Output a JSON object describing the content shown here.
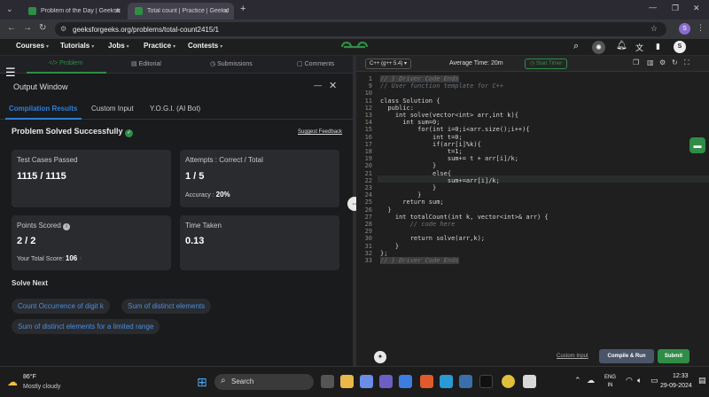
{
  "browser": {
    "tabs": [
      {
        "label": "Problem of the Day | GeeksforG"
      },
      {
        "label": "Total count | Practice | Geeksfo"
      }
    ],
    "url": "geeksforgeeks.org/problems/total-count2415/1",
    "profile_initial": "S"
  },
  "header": {
    "menus": [
      "Courses",
      "Tutorials",
      "Jobs",
      "Practice",
      "Contests"
    ],
    "profile_initial": "S"
  },
  "left": {
    "tabs": [
      "Problem",
      "Editorial",
      "Submissions",
      "Comments"
    ],
    "output_title": "Output Window",
    "subtabs": [
      "Compilation Results",
      "Custom Input",
      "Y.O.G.I. (AI Bot)"
    ],
    "status": "Problem Solved Successfully",
    "feedback_link": "Suggest Feedback",
    "cards": {
      "test_cases_label": "Test Cases Passed",
      "test_cases_value": "1115 / 1115",
      "attempts_label": "Attempts : Correct / Total",
      "attempts_value": "1 / 5",
      "accuracy_label": "Accuracy :",
      "accuracy_value": "20%",
      "points_label": "Points Scored",
      "points_value": "2 / 2",
      "total_score_label": "Your Total Score:",
      "total_score_value": "106",
      "time_label": "Time Taken",
      "time_value": "0.13"
    },
    "solve_next_title": "Solve Next",
    "solve_next": [
      "Count Occurrence of digit k",
      "Sum of distinct elements",
      "Sum of distinct elements for a limited range"
    ]
  },
  "editor": {
    "language": "C++ (g++ 5.4)",
    "average_time": "Average Time: 20m",
    "start_timer": "Start Timer",
    "lines": [
      {
        "n": "1",
        "t": "// } Driver Code Ends"
      },
      {
        "n": "9",
        "t": "// User function template for C++"
      },
      {
        "n": "10",
        "t": ""
      },
      {
        "n": "11",
        "t": "class Solution {"
      },
      {
        "n": "12",
        "t": "  public:"
      },
      {
        "n": "13",
        "t": "    int solve(vector<int> arr,int k){"
      },
      {
        "n": "14",
        "t": "      int sum=0;"
      },
      {
        "n": "15",
        "t": "          for(int i=0;i<arr.size();i++){"
      },
      {
        "n": "16",
        "t": "              int t=0;"
      },
      {
        "n": "17",
        "t": "              if(arr[i]%k){"
      },
      {
        "n": "18",
        "t": "                  t=1;"
      },
      {
        "n": "19",
        "t": "                  sum+= t + arr[i]/k;"
      },
      {
        "n": "20",
        "t": "              }"
      },
      {
        "n": "21",
        "t": "              else{"
      },
      {
        "n": "22",
        "t": "                  sum+=arr[i]/k;"
      },
      {
        "n": "23",
        "t": "              }"
      },
      {
        "n": "24",
        "t": "          }"
      },
      {
        "n": "25",
        "t": "      return sum;"
      },
      {
        "n": "26",
        "t": "  }"
      },
      {
        "n": "27",
        "t": "    int totalCount(int k, vector<int>& arr) {"
      },
      {
        "n": "28",
        "t": "        // code here"
      },
      {
        "n": "29",
        "t": ""
      },
      {
        "n": "30",
        "t": "        return solve(arr,k);"
      },
      {
        "n": "31",
        "t": "    }"
      },
      {
        "n": "32",
        "t": "};"
      },
      {
        "n": "33",
        "t": "// } Driver Code Ends"
      }
    ],
    "custom_input": "Custom Input",
    "compile_run": "Compile & Run",
    "submit": "Submit"
  },
  "taskbar": {
    "weather_temp": "86°F",
    "weather_desc": "Mostly cloudy",
    "search_placeholder": "Search",
    "lang1": "ENG",
    "lang2": "IN",
    "time": "12:33",
    "date": "29-09-2024"
  },
  "colors": {
    "accent_green": "#2f8d46",
    "link_blue": "#2d7fd8"
  }
}
